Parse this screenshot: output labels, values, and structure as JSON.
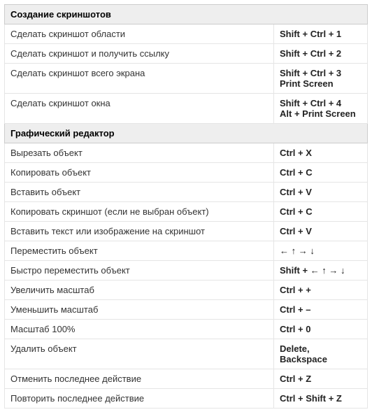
{
  "sections": [
    {
      "title": "Создание скриншотов",
      "rows": [
        {
          "desc": "Сделать скриншот области",
          "keys": [
            "Shift + Ctrl + 1"
          ]
        },
        {
          "desc": "Сделать скриншот и получить ссылку",
          "keys": [
            "Shift + Ctrl + 2"
          ]
        },
        {
          "desc": "Сделать скриншот всего экрана",
          "keys": [
            "Shift + Ctrl + 3",
            "Print Screen"
          ]
        },
        {
          "desc": "Сделать скриншот окна",
          "keys": [
            "Shift + Ctrl + 4",
            "Alt + Print Screen"
          ]
        }
      ]
    },
    {
      "title": "Графический редактор",
      "rows": [
        {
          "desc": "Вырезать объект",
          "keys": [
            "Ctrl + X"
          ]
        },
        {
          "desc": "Копировать объект",
          "keys": [
            "Ctrl + C"
          ]
        },
        {
          "desc": "Вставить объект",
          "keys": [
            "Ctrl + V"
          ]
        },
        {
          "desc": "Копировать скриншот (если не выбран объект)",
          "keys": [
            "Ctrl + C"
          ]
        },
        {
          "desc": "Вставить текст или изображение на скриншот",
          "keys": [
            "Ctrl + V"
          ]
        },
        {
          "desc": "Переместить объект",
          "keys": [
            "← ↑ → ↓"
          ]
        },
        {
          "desc": "Быстро переместить объект",
          "keys": [
            "Shift + ← ↑ → ↓"
          ]
        },
        {
          "desc": "Увеличить масштаб",
          "keys": [
            "Ctrl + +"
          ]
        },
        {
          "desc": "Уменьшить масштаб",
          "keys": [
            "Ctrl + –"
          ]
        },
        {
          "desc": "Масштаб 100%",
          "keys": [
            "Ctrl + 0"
          ]
        },
        {
          "desc": "Удалить объект",
          "keys": [
            "Delete,",
            "Backspace"
          ]
        },
        {
          "desc": "Отменить последнее действие",
          "keys": [
            "Ctrl + Z"
          ]
        },
        {
          "desc": "Повторить последнее действие",
          "keys": [
            "Ctrl + Shift + Z"
          ]
        }
      ]
    }
  ]
}
